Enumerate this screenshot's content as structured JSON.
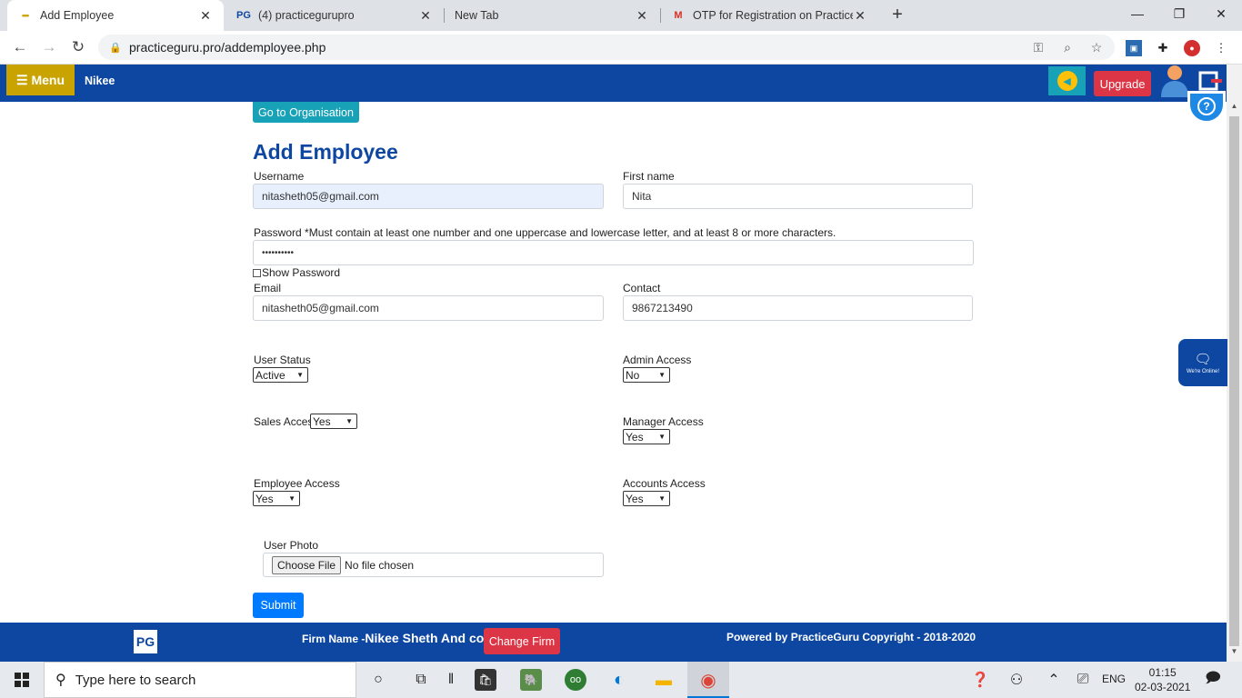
{
  "browser": {
    "tabs": [
      {
        "title": "Add Employee",
        "active": true
      },
      {
        "title": "(4) practicegurupro",
        "active": false
      },
      {
        "title": "New Tab",
        "active": false
      },
      {
        "title": "OTP for Registration on PracticeG",
        "active": false
      }
    ],
    "url": "practiceguru.pro/addemployee.php"
  },
  "appbar": {
    "menu_label": "☰ Menu",
    "user_name": "Nikee",
    "upgrade_label": "Upgrade"
  },
  "form": {
    "go_to_org_label": "Go to Organisation",
    "title": "Add Employee",
    "username_label": "Username",
    "username_value": "nitasheth05@gmail.com",
    "firstname_label": "First name",
    "firstname_value": "Nita",
    "password_label": "Password *Must contain at least one number and one uppercase and lowercase letter, and at least 8 or more characters.",
    "password_value": "••••••••••",
    "show_password_label": "Show Password",
    "email_label": "Email",
    "email_value": "nitasheth05@gmail.com",
    "contact_label": "Contact",
    "contact_value": "9867213490",
    "user_status_label": "User Status",
    "user_status_value": "Active",
    "admin_access_label": "Admin Access",
    "admin_access_value": "No",
    "sales_access_label": "Sales Access",
    "sales_access_value": "Yes",
    "manager_access_label": "Manager Access",
    "manager_access_value": "Yes",
    "employee_access_label": "Employee Access",
    "employee_access_value": "Yes",
    "accounts_access_label": "Accounts Access",
    "accounts_access_value": "Yes",
    "user_photo_label": "User Photo",
    "choose_file_label": "Choose File",
    "no_file_label": "No file chosen",
    "submit_label": "Submit"
  },
  "chat": {
    "status_text": "We're Online!"
  },
  "footer": {
    "logo_text": "PG",
    "firm_prefix": "Firm Name -",
    "firm_name": "Nikee Sheth And co",
    "change_firm_label": "Change Firm",
    "powered_text": "Powered by PracticeGuru Copyright - 2018-2020"
  },
  "taskbar": {
    "search_placeholder": "Type here to search",
    "language": "ENG",
    "time": "01:15",
    "date": "02-03-2021"
  },
  "colors": {
    "brand_blue": "#0d47a1",
    "menu_gold": "#c9a400",
    "danger": "#dc3545",
    "teal": "#17a2b8",
    "primary": "#007bff"
  }
}
